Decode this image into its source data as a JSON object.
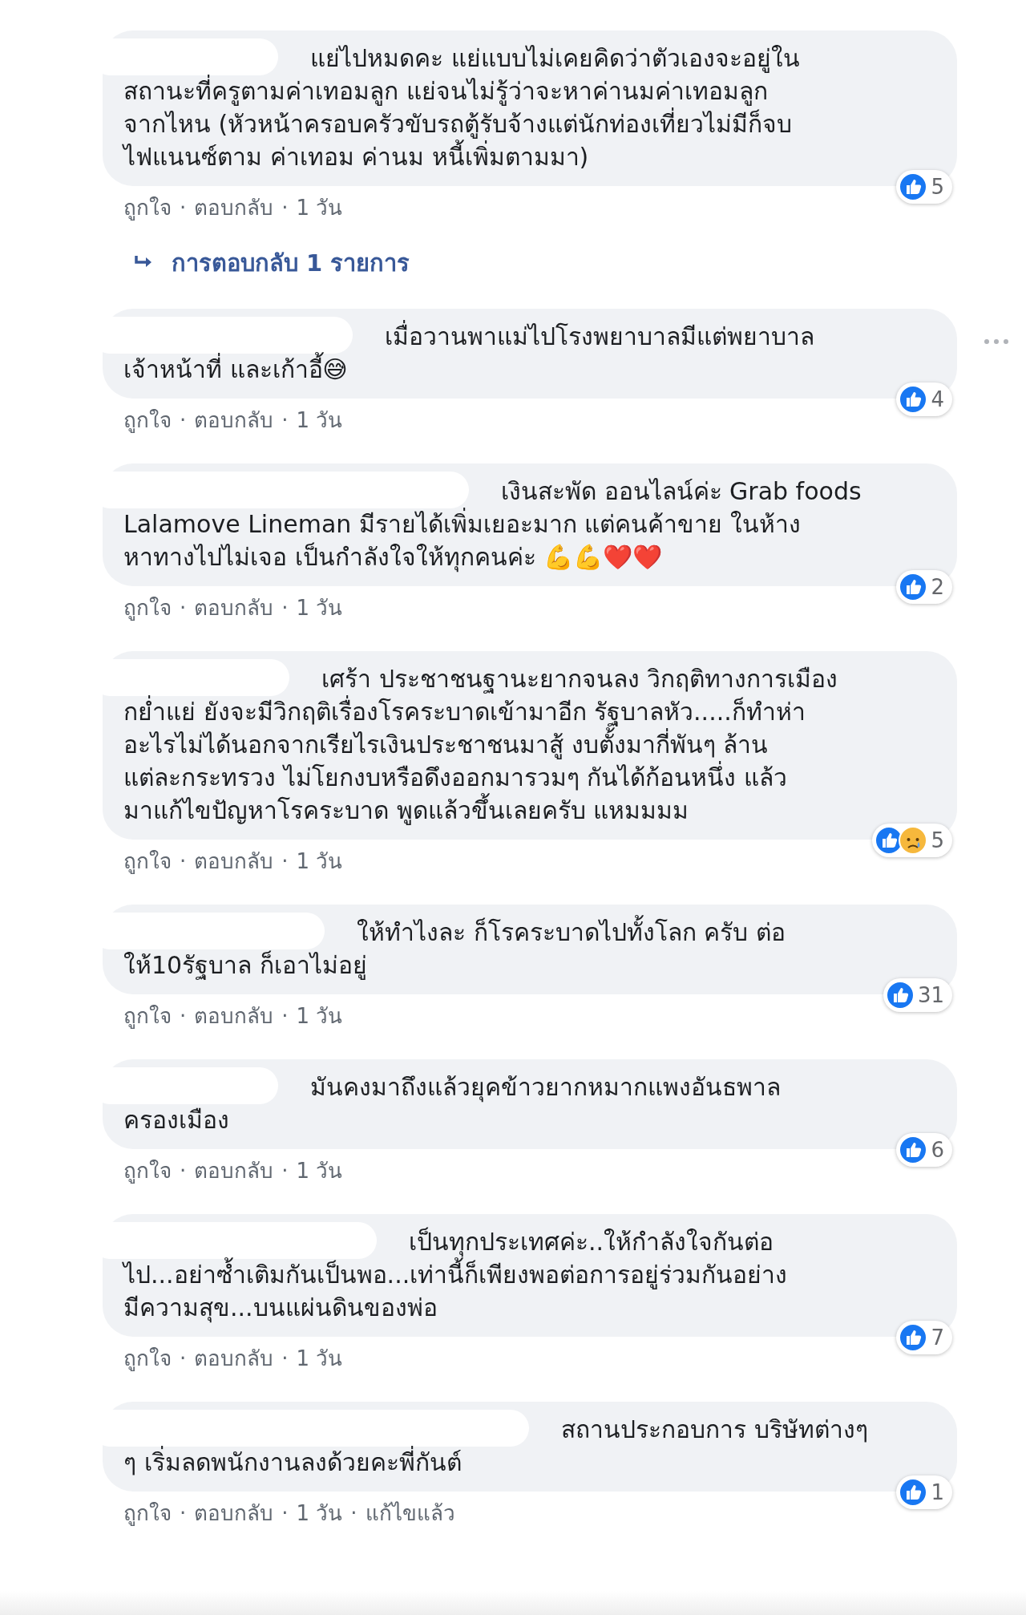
{
  "separator": "·",
  "comments": [
    {
      "text": "แย่ไปหมดคะ แย่แบบไม่เคยคิดว่าตัวเองจะอยู่ใน\nสถานะที่ครูตามค่าเทอมลูก แย่จนไม่รู้ว่าจะหาค่านมค่าเทอมลูก\nจากไหน (หัวหน้าครอบครัวขับรถตู้รับจ้างแต่นักท่องเที่ยวไม่มีก็จบ\nไฟแนนซ์ตาม ค่าเทอม ค่านม หนี้เพิ่มตามมา)",
      "reactions": [
        {
          "kind": "like"
        }
      ],
      "reaction_count": "5",
      "actions": [
        "ถูกใจ",
        "ตอบกลับ"
      ],
      "time": "1 วัน",
      "hovered": false,
      "replies": "การตอบกลับ 1 รายการ"
    },
    {
      "text": "เมื่อวานพาแม่ไปโรงพยาบาลมีแต่พยาบาล\nเจ้าหน้าที่ และเก้าอี้😅",
      "reactions": [
        {
          "kind": "like"
        }
      ],
      "reaction_count": "4",
      "actions": [
        "ถูกใจ",
        "ตอบกลับ"
      ],
      "time": "1 วัน",
      "hovered": true
    },
    {
      "text": "เงินสะพัด ออนไลน์ค่ะ Grab foods\nLalamove Lineman มีรายได้เพิ่มเยอะมาก แต่คนค้าขาย ในห้าง\nหาทางไปไม่เจอ เป็นกำลังใจให้ทุกคนค่ะ 💪💪❤️❤️",
      "reactions": [
        {
          "kind": "like"
        }
      ],
      "reaction_count": "2",
      "actions": [
        "ถูกใจ",
        "ตอบกลับ"
      ],
      "time": "1 วัน",
      "hovered": false
    },
    {
      "text": "เศร้า ประชาชนฐานะยากจนลง วิกฤติทางการเมือง\nกย่ำแย่ ยังจะมีวิกฤติเรื่องโรคระบาดเข้ามาอีก รัฐบาลหัว.....ก็ทำห่า\nอะไรไม่ได้นอกจากเรียไรเงินประชาชนมาสู้ งบตั้งมากี่พันๆ ล้าน\nแต่ละกระทรวง ไม่โยกงบหรือดึงออกมารวมๆ กันได้ก้อนหนึ่ง แล้ว\nมาแก้ไขปัญหาโรคระบาด พูดแล้วขึ้นเลยครับ แหมมมม",
      "reactions": [
        {
          "kind": "like"
        },
        {
          "kind": "sad"
        }
      ],
      "reaction_count": "5",
      "actions": [
        "ถูกใจ",
        "ตอบกลับ"
      ],
      "time": "1 วัน",
      "hovered": false
    },
    {
      "text": "ให้ทำไงละ ก็โรคระบาดไปทั้งโลก ครับ ต่อ\nให้10รัฐบาล ก็เอาไม่อยู่",
      "reactions": [
        {
          "kind": "like"
        }
      ],
      "reaction_count": "31",
      "actions": [
        "ถูกใจ",
        "ตอบกลับ"
      ],
      "time": "1 วัน",
      "hovered": false
    },
    {
      "text": "มันคงมาถึงแล้วยุคข้าวยากหมากแพงอันธพาล\nครองเมือง",
      "reactions": [
        {
          "kind": "like"
        }
      ],
      "reaction_count": "6",
      "actions": [
        "ถูกใจ",
        "ตอบกลับ"
      ],
      "time": "1 วัน",
      "hovered": false
    },
    {
      "text": "เป็นทุกประเทศค่ะ..ให้กำลังใจกันต่อ\nไป...อย่าซ้ำเติมกันเป็นพอ...เท่านี้ก็เพียงพอต่อการอยู่ร่วมกันอย่าง\nมีความสุข...บนแผ่นดินของพ่อ",
      "reactions": [
        {
          "kind": "like"
        }
      ],
      "reaction_count": "7",
      "actions": [
        "ถูกใจ",
        "ตอบกลับ"
      ],
      "time": "1 วัน",
      "hovered": false
    },
    {
      "text": "สถานประกอบการ บริษัทต่างๆ\nๆ เริ่มลดพนักงานลงด้วยคะพี่กันต์",
      "reactions": [
        {
          "kind": "like"
        }
      ],
      "reaction_count": "1",
      "actions": [
        "ถูกใจ",
        "ตอบกลับ"
      ],
      "time": "1 วัน",
      "edited": "แก้ไขแล้ว",
      "hovered": false
    }
  ]
}
